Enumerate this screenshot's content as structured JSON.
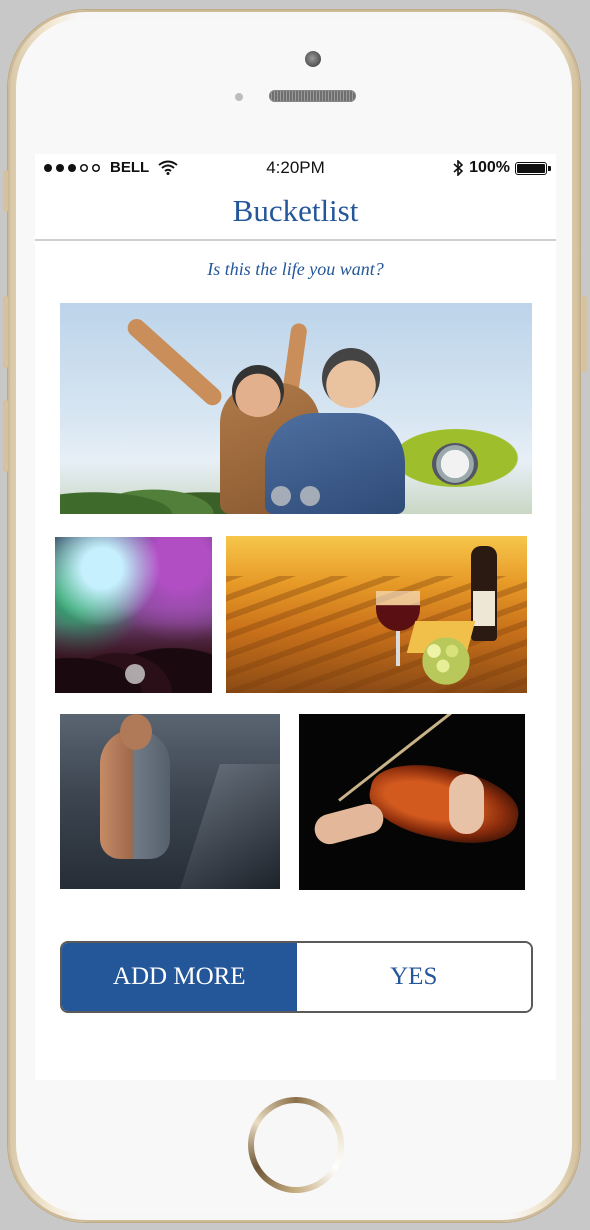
{
  "status_bar": {
    "signal_dots": 5,
    "signal_filled": 3,
    "carrier": "BELL",
    "time": "4:20PM",
    "battery_pct": "100%",
    "battery_level": 1.0
  },
  "nav": {
    "title": "Bucketlist"
  },
  "subtitle": "Is this the life you want?",
  "hero": {
    "image": "couple-on-scooter",
    "pager_dots": 2
  },
  "gallery": [
    {
      "image": "concert-crowd"
    },
    {
      "image": "vineyard-wine-cheese"
    },
    {
      "image": "treadmill-runner"
    },
    {
      "image": "violin-player"
    }
  ],
  "actions": {
    "add_more_label": "ADD MORE",
    "yes_label": "YES"
  },
  "colors": {
    "primary": "#24579a",
    "background": "#ffffff",
    "divider": "#cfcfcf"
  }
}
